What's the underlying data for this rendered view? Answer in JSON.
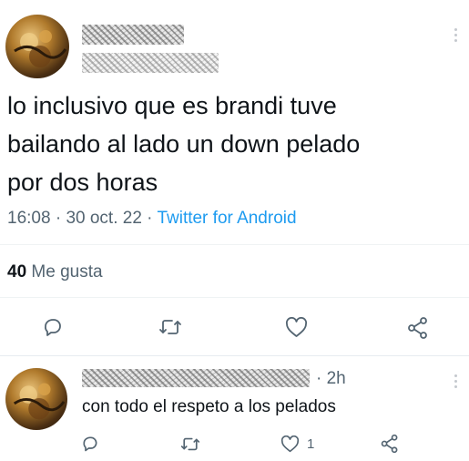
{
  "main_tweet": {
    "text": "lo inclusivo que es brandi tuve\nbailando al lado un down pelado\npor dos horas",
    "time": "16:08",
    "date": "30 oct. 22",
    "source": "Twitter for Android",
    "sep": "·",
    "likes_count": "40",
    "likes_label": "Me gusta"
  },
  "reply": {
    "age": "· 2h",
    "text": "con todo el respeto a los pelados",
    "like_count": "1"
  },
  "icons": {
    "reply": "reply-icon",
    "retweet": "retweet-icon",
    "like": "heart-icon",
    "share": "share-icon",
    "more": "more-icon"
  },
  "colors": {
    "text": "#0f1419",
    "secondary": "#536471",
    "link": "#1d9bf0",
    "divider": "#eff3f4"
  }
}
